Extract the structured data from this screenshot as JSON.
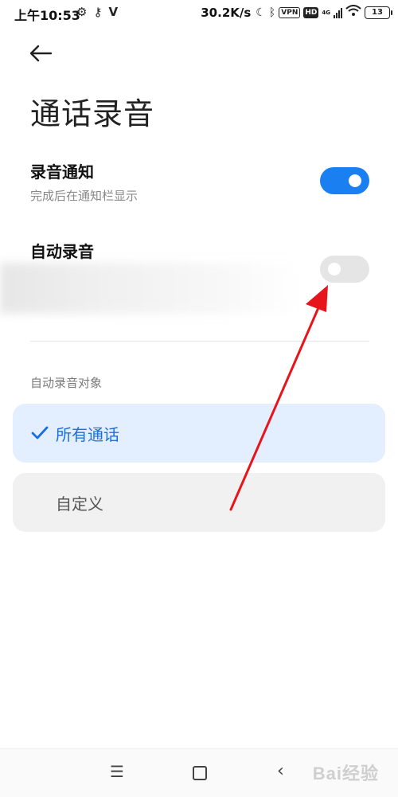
{
  "status_bar": {
    "time": "上午10:53",
    "left_icons": [
      "gear-icon",
      "key-icon",
      "v-app-icon"
    ],
    "network_speed": "30.2K/s",
    "vpn_label": "VPN",
    "hd_label": "HD",
    "signal_label": "4G",
    "battery": "13"
  },
  "page": {
    "title": "通话录音"
  },
  "settings": {
    "notify": {
      "title": "录音通知",
      "subtitle": "完成后在通知栏显示",
      "enabled": true
    },
    "auto_record": {
      "title": "自动录音",
      "enabled": false
    }
  },
  "section": {
    "label": "自动录音对象",
    "options": [
      {
        "label": "所有通话",
        "selected": true
      },
      {
        "label": "自定义",
        "selected": false
      }
    ]
  },
  "nav": {
    "icons": [
      "menu-icon",
      "home-icon",
      "back-icon"
    ]
  },
  "watermark": "Bai经验",
  "colors": {
    "accent": "#1a7ff0",
    "selected_bg": "#e3efff",
    "annotation": "#e8141c"
  }
}
